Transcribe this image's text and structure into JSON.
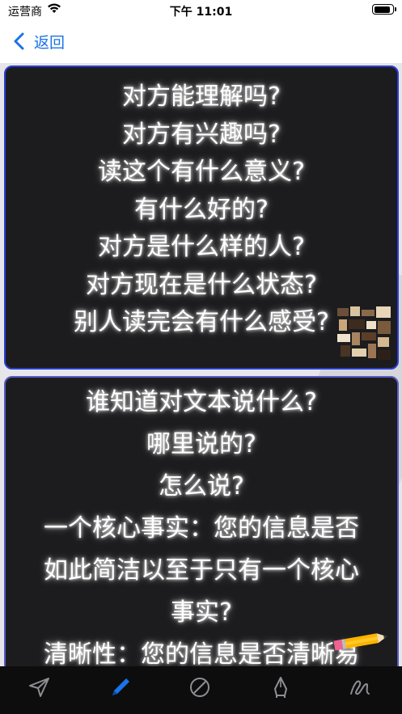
{
  "status_bar": {
    "carrier": "运营商",
    "time": "下午 11:01"
  },
  "nav": {
    "back_label": "返回"
  },
  "cards": [
    {
      "lines": [
        "对方能理解吗?",
        "对方有兴趣吗?",
        "读这个有什么意义?",
        "有什么好的?",
        "对方是什么样的人?",
        "对方现在是什么状态?",
        "别人读完会有什么感受?"
      ]
    },
    {
      "lines": [
        "谁知道对文本说什么?",
        "哪里说的?",
        "怎么说?",
        "一个核心事实：您的信息是否",
        "如此简洁以至于只有一个核心",
        "事实?",
        "清晰性：您的信息是否清晰易"
      ]
    }
  ],
  "toolbar": {
    "tools": [
      {
        "name": "send-tool",
        "icon": "paper-plane-icon"
      },
      {
        "name": "pen-tool",
        "icon": "pen-icon",
        "active": true
      },
      {
        "name": "eraser-tool",
        "icon": "no-entry-icon"
      },
      {
        "name": "text-tool",
        "icon": "pen-nib-icon"
      },
      {
        "name": "draw-tool",
        "icon": "scribble-icon"
      }
    ]
  },
  "colors": {
    "accent": "#1a73e8",
    "card_bg": "#1c1c1e",
    "card1_border": "#2b3fd6",
    "card2_border": "#5a5ac8",
    "toolbar_bg": "#0d0d0d"
  }
}
